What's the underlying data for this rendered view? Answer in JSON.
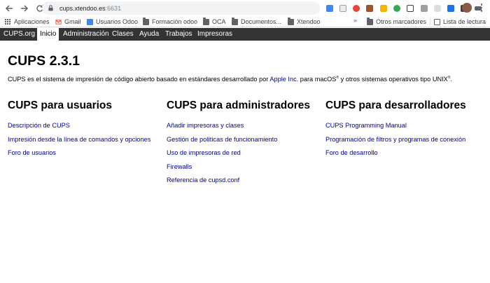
{
  "browser": {
    "address_host": "cups.xtendoo.es",
    "address_port": ":6631",
    "bookmarks": [
      {
        "label": "Aplicaciones",
        "icon": "apps-grid-icon"
      },
      {
        "label": "Gmail",
        "icon": "gmail-icon"
      },
      {
        "label": "Usuarios Odoo",
        "icon": "docs-icon"
      },
      {
        "label": "Formación odoo",
        "icon": "folder-icon"
      },
      {
        "label": "OCA",
        "icon": "folder-icon"
      },
      {
        "label": "Documentos...",
        "icon": "folder-icon"
      },
      {
        "label": "Xtendoo",
        "icon": "folder-icon"
      }
    ],
    "more_chevron": "»",
    "other_bookmarks": "Otros marcadores",
    "reading_list": "Lista de lectura",
    "colors": {
      "toolbar_bg": "#ffffff",
      "omnibox_bg": "#f1f3f4"
    }
  },
  "cups_nav": {
    "items": [
      {
        "label": "CUPS.org",
        "active": false
      },
      {
        "label": "Inicio",
        "active": true
      },
      {
        "label": "Administración",
        "active": false
      },
      {
        "label": "Clases",
        "active": false
      },
      {
        "label": "Ayuda",
        "active": false
      },
      {
        "label": "Trabajos",
        "active": false
      },
      {
        "label": "Impresoras",
        "active": false
      }
    ],
    "colors": {
      "bar_bg": "#333333",
      "active_bg": "#ffffff"
    }
  },
  "main": {
    "title": "CUPS 2.3.1",
    "intro": {
      "before_link": "CUPS es el sistema de impresión de código abierto basado en estándares desarrollado por ",
      "link": "Apple Inc.",
      "middle": " para macOS",
      "reg1": "®",
      "after": " y otros sistemas operativos tipo UNIX",
      "reg2": "®",
      "end": "."
    },
    "columns": [
      {
        "heading": "CUPS para usuarios",
        "links": [
          "Descripción de CUPS",
          "Impresión desde la línea de comandos y opciones",
          "Foro de usuarios"
        ]
      },
      {
        "heading": "CUPS para administradores",
        "links": [
          "Añadir impresoras y clases",
          "Gestión de políticas de funcionamiento",
          "Uso de impresoras de red",
          "Firewalls",
          "Referencia de cupsd.conf"
        ]
      },
      {
        "heading": "CUPS para desarrolladores",
        "links": [
          "CUPS Programming Manual",
          "Programación de filtros y programas de conexión",
          "Foro de desarrollo"
        ]
      }
    ],
    "link_color": "#000099"
  }
}
